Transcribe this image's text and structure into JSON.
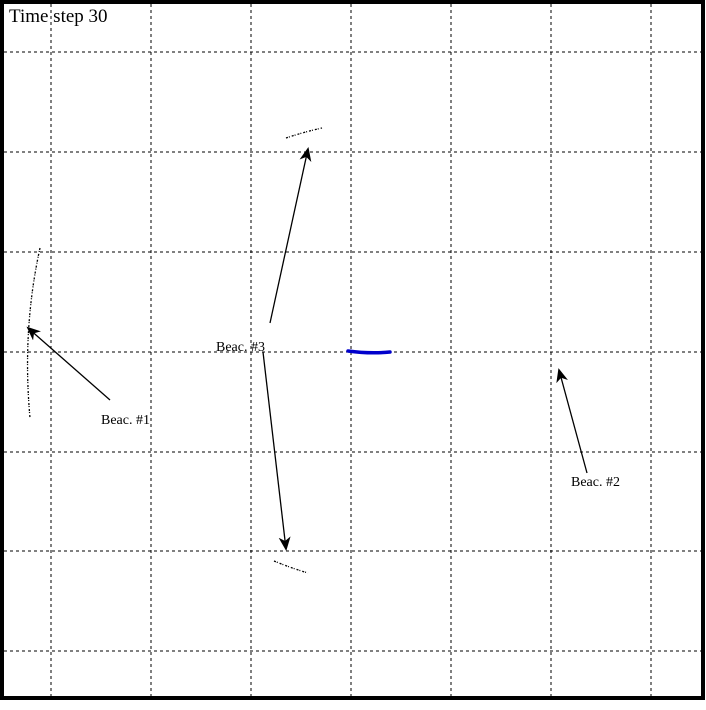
{
  "title": "Time step 30",
  "beacons": [
    {
      "id": "beacon-1",
      "label": "Beac. #1"
    },
    {
      "id": "beacon-2",
      "label": "Beac. #2"
    },
    {
      "id": "beacon-3",
      "label": "Beac. #3"
    }
  ],
  "colors": {
    "background": "#ffffff",
    "frame": "#000000",
    "grid": "#000000",
    "robot_path": "#0000cc",
    "particles": "#000000",
    "arrows": "#000000"
  },
  "grid": {
    "style": "dashed",
    "columns": 7,
    "rows": 7
  }
}
